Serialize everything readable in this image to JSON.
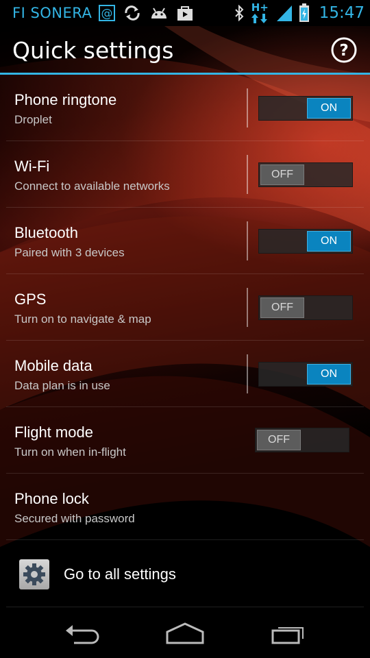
{
  "status_bar": {
    "carrier": "FI SONERA",
    "network_type": "H+",
    "clock": "15:47",
    "icons_left": [
      "at-sign-icon",
      "sync-icon",
      "android-icon",
      "shop-bag-icon"
    ],
    "icons_right": [
      "bluetooth-icon",
      "data-arrows-icon",
      "signal-icon",
      "battery-icon"
    ]
  },
  "header": {
    "title": "Quick settings",
    "help_label": "?"
  },
  "settings": [
    {
      "title": "Phone ringtone",
      "subtitle": "Droplet",
      "state": "ON",
      "on": true
    },
    {
      "title": "Wi-Fi",
      "subtitle": "Connect to available networks",
      "state": "OFF",
      "on": false
    },
    {
      "title": "Bluetooth",
      "subtitle": "Paired with 3 devices",
      "state": "ON",
      "on": true
    },
    {
      "title": "GPS",
      "subtitle": "Turn on to navigate & map",
      "state": "OFF",
      "on": false
    },
    {
      "title": "Mobile data",
      "subtitle": "Data plan is in use",
      "state": "ON",
      "on": true
    },
    {
      "title": "Flight mode",
      "subtitle": "Turn on when in-flight",
      "state": "OFF",
      "on": false
    },
    {
      "title": "Phone lock",
      "subtitle": "Secured with password"
    }
  ],
  "all_settings": {
    "label": "Go to all settings",
    "icon": "gear-icon"
  },
  "nav": {
    "icons": [
      "back-icon",
      "home-icon",
      "recent-apps-icon"
    ]
  },
  "colors": {
    "accent": "#33b5e5",
    "toggle_on": "#0a84bf",
    "toggle_off": "#5c5c5c"
  }
}
